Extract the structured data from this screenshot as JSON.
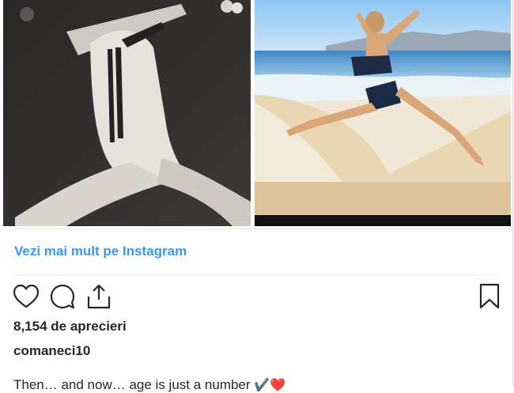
{
  "post": {
    "images": [
      {
        "alt_name": "vintage-gymnast-photo"
      },
      {
        "alt_name": "beach-jump-photo"
      }
    ],
    "see_more_label": "Vezi mai mult pe Instagram",
    "likes_text": "8,154 de aprecieri",
    "username": "comaneci10",
    "caption_text": "Then… and now… age is just a number",
    "caption_emojis": "✔️❤️"
  },
  "icons": {
    "like": "heart-icon",
    "comment": "comment-icon",
    "share": "share-icon",
    "save": "bookmark-icon"
  },
  "colors": {
    "link": "#3897f0",
    "text": "#262626",
    "border": "#dbdbdb"
  }
}
